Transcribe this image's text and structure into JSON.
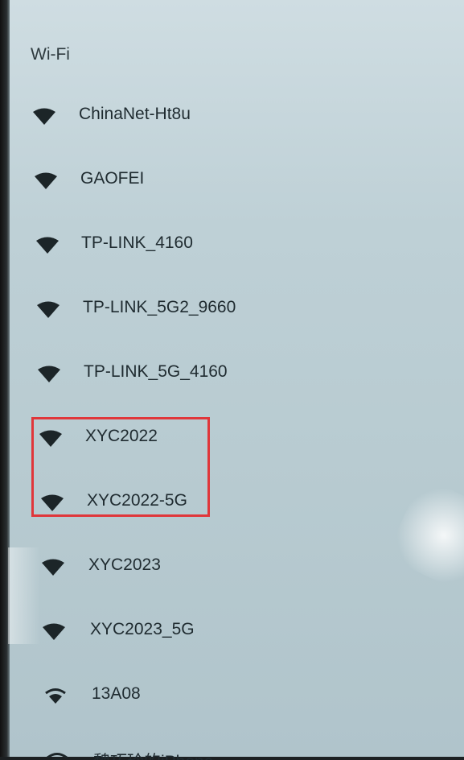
{
  "header": {
    "title": "Wi-Fi"
  },
  "networks": [
    {
      "ssid": "ChinaNet-Ht8u",
      "icon": "wifi-full-icon"
    },
    {
      "ssid": "GAOFEI",
      "icon": "wifi-full-icon"
    },
    {
      "ssid": "TP-LINK_4160",
      "icon": "wifi-full-icon"
    },
    {
      "ssid": "TP-LINK_5G2_9660",
      "icon": "wifi-full-icon"
    },
    {
      "ssid": "TP-LINK_5G_4160",
      "icon": "wifi-full-icon"
    },
    {
      "ssid": "XYC2022",
      "icon": "wifi-full-icon"
    },
    {
      "ssid": "XYC2022-5G",
      "icon": "wifi-full-icon"
    },
    {
      "ssid": "XYC2023",
      "icon": "wifi-full-icon"
    },
    {
      "ssid": "XYC2023_5G",
      "icon": "wifi-full-icon"
    },
    {
      "ssid": "13A08",
      "icon": "wifi-partial-icon"
    },
    {
      "ssid": "魏巧玲的iPhone",
      "icon": "wifi-partial-icon"
    }
  ],
  "highlight": {
    "color": "#e0363a",
    "covers": [
      "XYC2022",
      "XYC2022-5G"
    ]
  }
}
